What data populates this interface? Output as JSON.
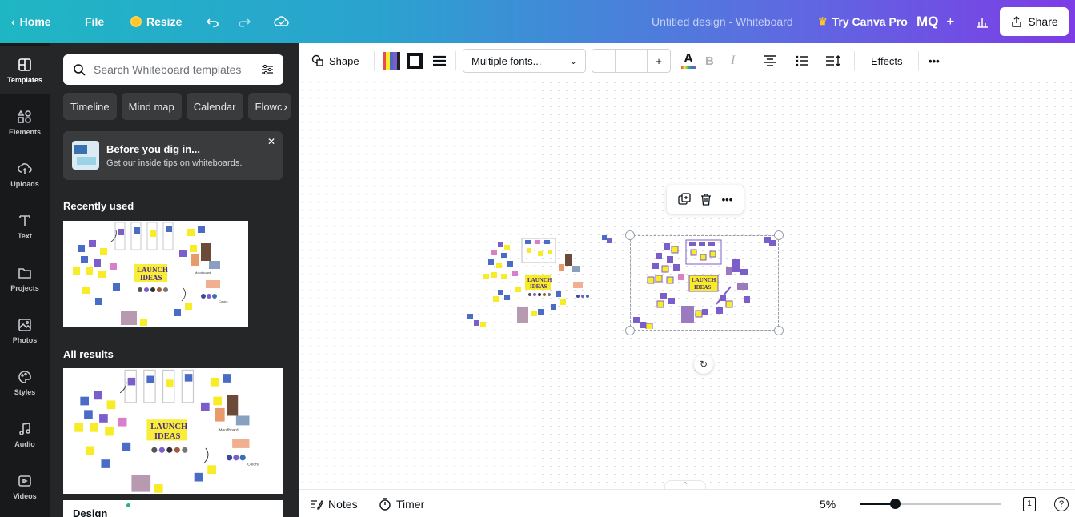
{
  "topbar": {
    "home": "Home",
    "file": "File",
    "resize": "Resize",
    "doc_title": "Untitled design - Whiteboard",
    "try_pro": "Try Canva Pro",
    "avatar": "MQ",
    "add": "+",
    "share": "Share",
    "icons": [
      "chevron-left-icon",
      "undo-icon",
      "redo-icon",
      "cloud-saved-icon",
      "crown-icon",
      "analytics-icon",
      "share-icon"
    ]
  },
  "rail": {
    "items": [
      {
        "label": "Templates",
        "icon": "templates-icon"
      },
      {
        "label": "Elements",
        "icon": "elements-icon"
      },
      {
        "label": "Uploads",
        "icon": "upload-icon"
      },
      {
        "label": "Text",
        "icon": "text-icon"
      },
      {
        "label": "Projects",
        "icon": "folder-icon"
      },
      {
        "label": "Photos",
        "icon": "photo-icon"
      },
      {
        "label": "Styles",
        "icon": "palette-icon"
      },
      {
        "label": "Audio",
        "icon": "music-icon"
      },
      {
        "label": "Videos",
        "icon": "video-icon"
      }
    ]
  },
  "panel": {
    "search_placeholder": "Search Whiteboard templates",
    "chips": [
      "Timeline",
      "Mind map",
      "Calendar",
      "Flowc"
    ],
    "tip": {
      "title": "Before you dig in...",
      "subtitle": "Get our inside tips on whiteboards."
    },
    "recently_used": "Recently used",
    "all_results": "All results",
    "thumb_text_1": "LAUNCH",
    "thumb_text_2": "IDEAS",
    "moodboard": "Moodboard",
    "colors": "Colors",
    "design_card": "Design"
  },
  "toolbar": {
    "shape": "Shape",
    "font": "Multiple fonts...",
    "size_minus": "-",
    "size_value": "--",
    "size_plus": "+",
    "bold": "B",
    "italic": "I",
    "effects": "Effects",
    "more": "•••"
  },
  "canvas": {
    "float_more": "•••",
    "board_text_1": "LAUNCH",
    "board_text_2": "IDEAS"
  },
  "bottombar": {
    "notes": "Notes",
    "timer": "Timer",
    "zoom": "5%",
    "zoom_fraction": 0.25,
    "page_number": "1",
    "help": "?"
  },
  "colors": {
    "accent": "#7d3ce6",
    "sticky_yellow": "#f7ec25",
    "sticky_purple": "#7b5ec9",
    "sticky_blue": "#4a6cc7",
    "sticky_pink": "#d97fc9"
  }
}
